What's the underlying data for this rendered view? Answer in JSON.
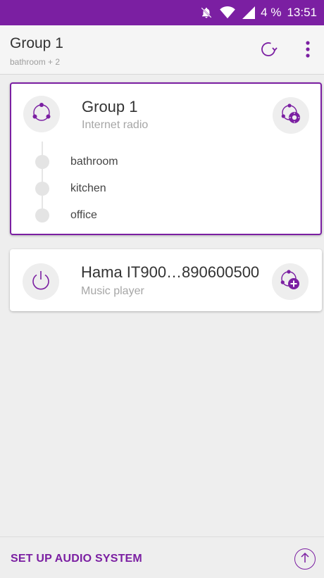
{
  "status_bar": {
    "battery": "4 %",
    "time": "13:51",
    "icons": [
      "notifications-off-icon",
      "wifi-icon",
      "signal-icon"
    ]
  },
  "app_bar": {
    "title": "Group 1",
    "subtitle": "bathroom + 2",
    "icons": [
      "refresh-icon",
      "more-vert-icon"
    ]
  },
  "group_card": {
    "name": "Group 1",
    "source": "Internet radio",
    "members": [
      {
        "label": "bathroom"
      },
      {
        "label": "kitchen"
      },
      {
        "label": "office"
      }
    ],
    "icon": "group-icon",
    "action_icon": "group-settings-icon"
  },
  "device_card": {
    "name": "Hama IT900…890600500",
    "source": "Music player",
    "icon": "power-icon",
    "action_icon": "add-to-group-icon"
  },
  "bottom_bar": {
    "setup_label": "SET UP AUDIO SYSTEM",
    "icon": "arrow-up-icon"
  },
  "colors": {
    "accent": "#7b1fa2",
    "background": "#eeeeee",
    "card": "#ffffff"
  }
}
